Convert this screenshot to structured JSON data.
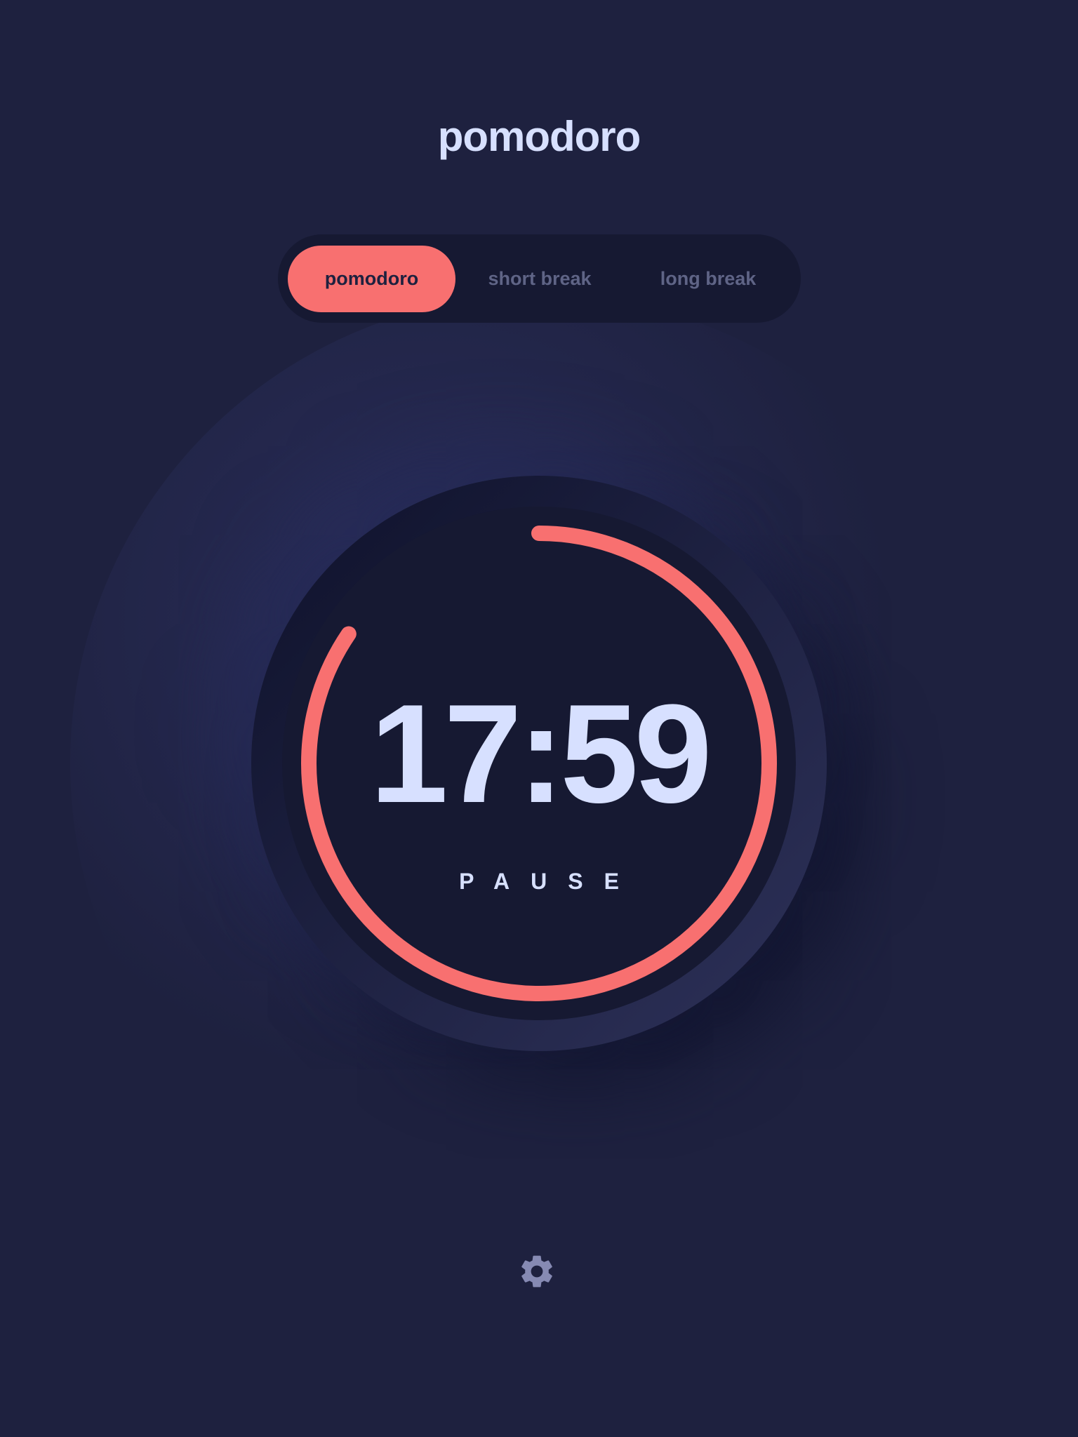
{
  "app": {
    "title": "pomodoro"
  },
  "tabs": [
    {
      "label": "pomodoro",
      "active": true
    },
    {
      "label": "short break",
      "active": false
    },
    {
      "label": "long break",
      "active": false
    }
  ],
  "timer": {
    "time": "17:59",
    "action_label": "PAUSE",
    "progress_remaining": 0.845
  },
  "settings": {
    "icon": "gear-icon"
  },
  "colors": {
    "background": "#1e213f",
    "accent": "#f87070",
    "text": "#d7e0ff",
    "muted": "#5f6486",
    "panel": "#161932"
  }
}
